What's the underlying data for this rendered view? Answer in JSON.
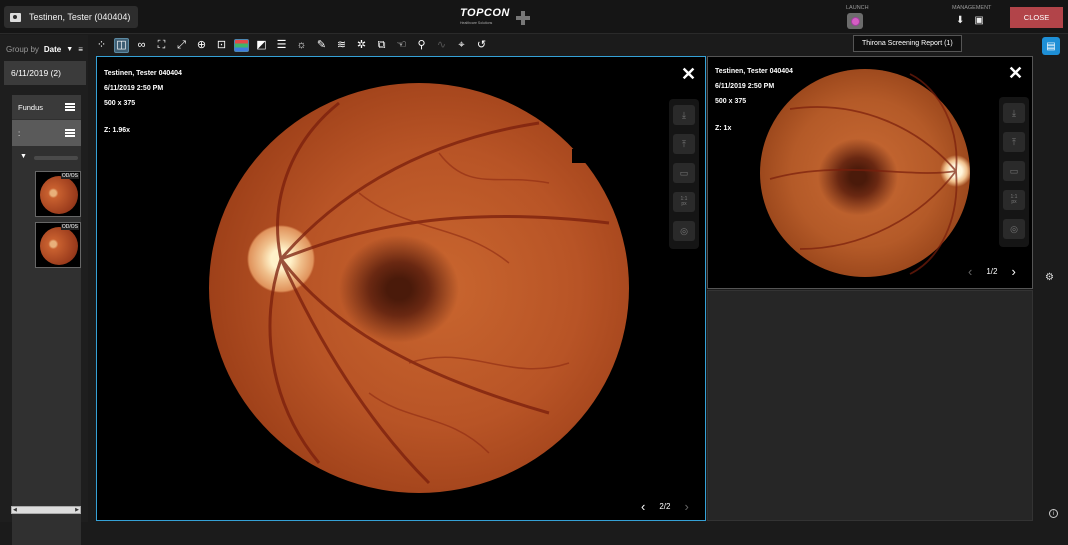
{
  "header": {
    "patient_label": "Testinen, Tester (040404)",
    "brand": "TOPCON",
    "brand_tagline": "Healthcare Solutions",
    "launch_label": "LAUNCH",
    "management_label": "MANAGEMENT",
    "close_label": "CLOSE",
    "tooltip": "Thirona Screening Report (1)"
  },
  "sidebar": {
    "group_by_label": "Group by",
    "group_by_value": "Date",
    "date_group": "6/11/2019 (2)",
    "modality": "Fundus",
    "sub_row": ":",
    "thumbnails": [
      {
        "badge": "OD/OS"
      },
      {
        "badge": "OD/OS"
      }
    ]
  },
  "toolbar": {
    "color_channels": [
      "#e03b3b",
      "#2fae5e",
      "#2f6fe0"
    ]
  },
  "main_viewer": {
    "patient": "Testinen, Tester 040404",
    "datetime": "6/11/2019 2:50 PM",
    "resolution": "500 x 375",
    "zoom": "Z: 1.96x",
    "page": "2/2",
    "one_to_one": "1:1",
    "px": "px"
  },
  "side_viewer": {
    "patient": "Testinen, Tester 040404",
    "datetime": "6/11/2019 2:50 PM",
    "resolution": "500 x 375",
    "zoom": "Z: 1x",
    "page": "1/2",
    "one_to_one": "1:1",
    "px": "px"
  },
  "colors": {
    "accent": "#35a1d6",
    "close_button": "#b24449",
    "report_button": "#1e8fd6"
  }
}
